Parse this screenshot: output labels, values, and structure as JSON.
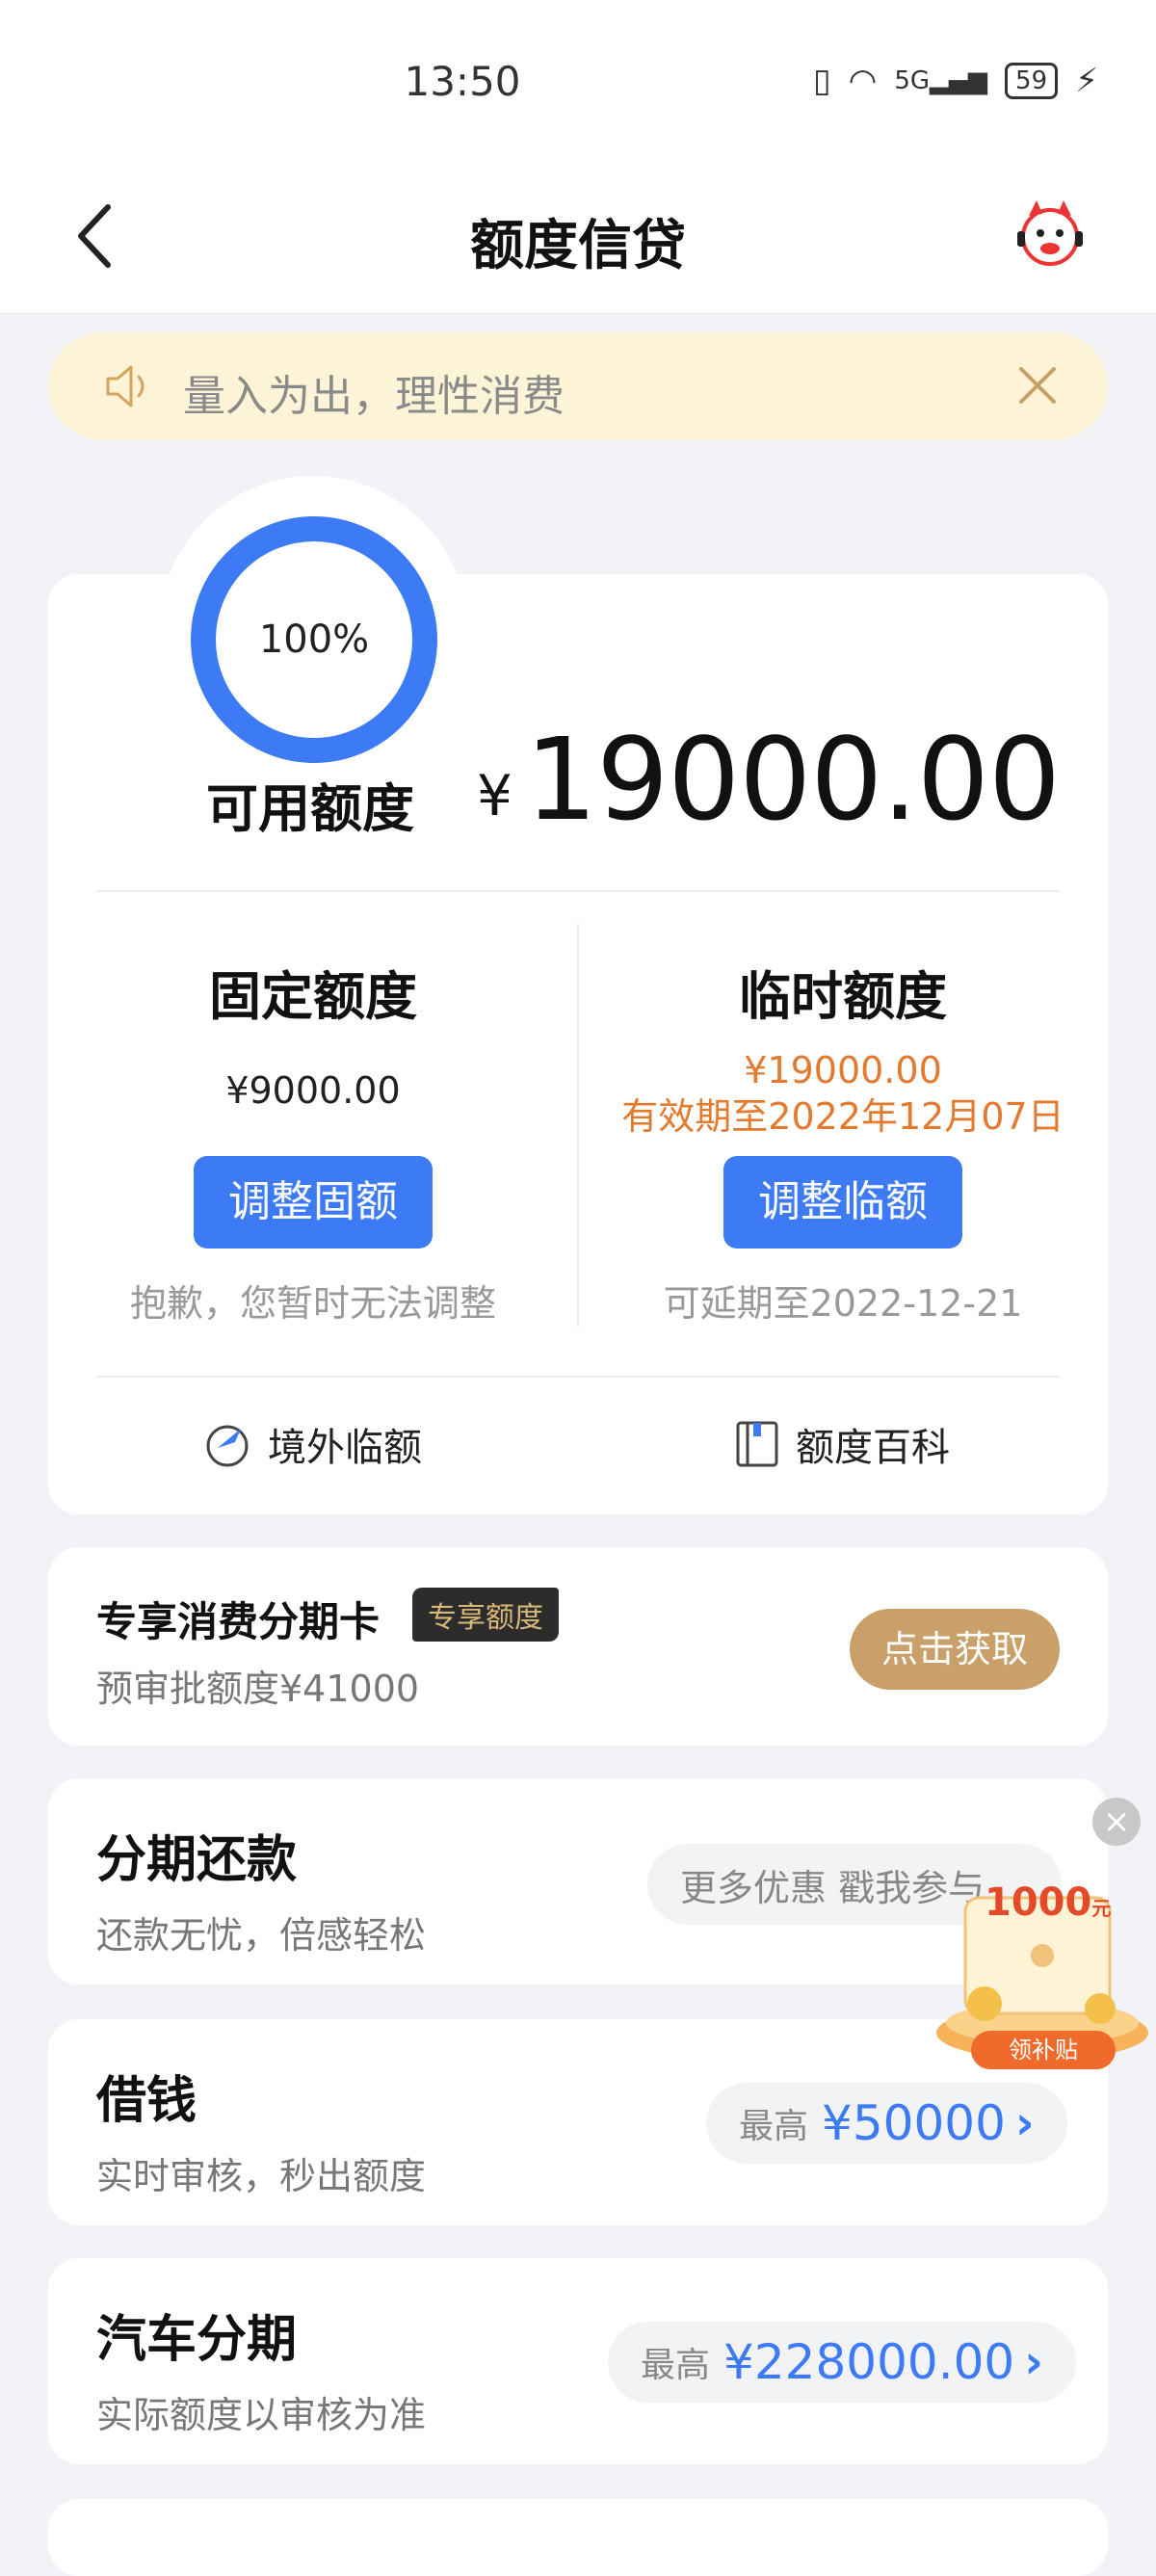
{
  "status": {
    "time": "13:50",
    "battery": "59",
    "network": "5G"
  },
  "nav": {
    "title": "额度信贷"
  },
  "notice": {
    "text": "量入为出，理性消费"
  },
  "credit": {
    "ring_percent": "100%",
    "available_label": "可用额度",
    "currency": "¥",
    "available_amount": "19000.00",
    "fixed": {
      "title": "固定额度",
      "value": "¥9000.00",
      "button": "调整固额",
      "note": "抱歉，您暂时无法调整"
    },
    "temp": {
      "title": "临时额度",
      "value": "¥19000.00",
      "validity": "有效期至2022年12月07日",
      "button": "调整临额",
      "note": "可延期至2022-12-21"
    },
    "links": {
      "overseas": "境外临额",
      "wiki": "额度百科"
    }
  },
  "installment_card": {
    "title": "专享消费分期卡",
    "badge": "专享额度",
    "subtitle": "预审批额度¥41000",
    "button": "点击获取"
  },
  "rows": [
    {
      "title": "分期还款",
      "subtitle": "还款无忧，倍感轻松",
      "promo": "更多优惠 戳我参与"
    },
    {
      "title": "借钱",
      "subtitle": "实时审核，秒出额度",
      "prefix": "最高",
      "value": "¥50000"
    },
    {
      "title": "汽车分期",
      "subtitle": "实际额度以审核为准",
      "prefix": "最高",
      "value": "¥228000.00"
    }
  ],
  "float_promo": {
    "amount": "1000",
    "unit": "元",
    "button": "领补贴"
  },
  "colors": {
    "primary": "#3d7af5",
    "orange": "#e37a2e",
    "gold": "#c9a06a",
    "notice_bg": "#fdf4d8"
  }
}
